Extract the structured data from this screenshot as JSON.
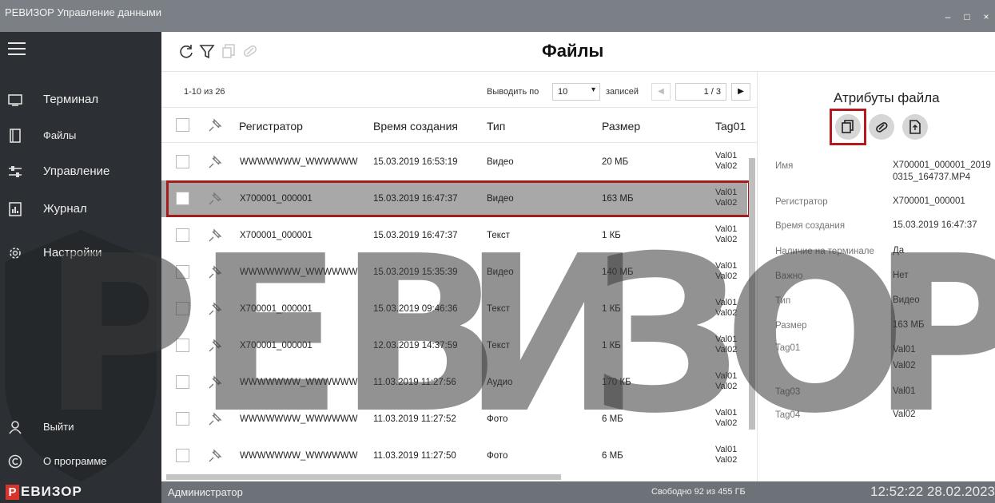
{
  "window": {
    "title": "РЕВИЗОР Управление данными",
    "buttons": [
      "–",
      "□",
      "×"
    ]
  },
  "sidebar": {
    "items": [
      {
        "label": "Терминал",
        "icon": "terminal-icon"
      },
      {
        "label": "Файлы",
        "icon": "files-icon"
      },
      {
        "label": "Управление",
        "icon": "sliders-icon"
      },
      {
        "label": "Журнал",
        "icon": "journal-icon"
      },
      {
        "label": "Настройки",
        "icon": "gear-icon"
      }
    ],
    "bottom": [
      {
        "label": "Выйти",
        "icon": "user-icon"
      },
      {
        "label": "О программе",
        "icon": "copyright-icon"
      }
    ]
  },
  "toolbar": {
    "title": "Файлы",
    "tools": [
      "refresh-icon",
      "filter-icon",
      "copy-icon",
      "erase-icon"
    ]
  },
  "pager": {
    "count_text": "1-10 из 26",
    "per_page_label": "Выводить по",
    "per_page_value": "10",
    "records_label": "записей",
    "page_text": "1 / 3",
    "prev": "◀",
    "next": "▶"
  },
  "table": {
    "columns": [
      "Регистратор",
      "Время создания",
      "Тип",
      "Размер",
      "Tag01"
    ],
    "rows": [
      {
        "registrator": "WWWWWWW_WWWWWW",
        "created": "15.03.2019 16:53:19",
        "type": "Видео",
        "size": "20 МБ",
        "tag1": "Val01",
        "tag2": "Val02"
      },
      {
        "registrator": "X700001_000001",
        "created": "15.03.2019 16:47:37",
        "type": "Видео",
        "size": "163 МБ",
        "tag1": "Val01",
        "tag2": "Val02"
      },
      {
        "registrator": "X700001_000001",
        "created": "15.03.2019 16:47:37",
        "type": "Текст",
        "size": "1 КБ",
        "tag1": "Val01",
        "tag2": "Val02"
      },
      {
        "registrator": "WWWWWWW_WWWWWW",
        "created": "15.03.2019 15:35:39",
        "type": "Видео",
        "size": "140 МБ",
        "tag1": "Val01",
        "tag2": "Val02"
      },
      {
        "registrator": "X700001_000001",
        "created": "15.03.2019 09:46:36",
        "type": "Текст",
        "size": "1 КБ",
        "tag1": "Val01",
        "tag2": "Val02"
      },
      {
        "registrator": "X700001_000001",
        "created": "12.03.2019 14:37:59",
        "type": "Текст",
        "size": "1 КБ",
        "tag1": "Val01",
        "tag2": "Val02"
      },
      {
        "registrator": "WWWWWWW_WWWWWW",
        "created": "11.03.2019 11:27:56",
        "type": "Аудио",
        "size": "170 КБ",
        "tag1": "Val01",
        "tag2": "Val02"
      },
      {
        "registrator": "WWWWWWW_WWWWWW",
        "created": "11.03.2019 11:27:52",
        "type": "Фото",
        "size": "6 МБ",
        "tag1": "Val01",
        "tag2": "Val02"
      },
      {
        "registrator": "WWWWWWW_WWWWWW",
        "created": "11.03.2019 11:27:50",
        "type": "Фото",
        "size": "6 МБ",
        "tag1": "Val01",
        "tag2": "Val02"
      }
    ],
    "selected_row_index": 1
  },
  "attributes": {
    "title": "Атрибуты файла",
    "buttons": [
      "copy-file-icon",
      "erase-icon",
      "export-file-icon"
    ],
    "fields": [
      {
        "key": "Имя",
        "value": "X700001_000001_2019\n0315_164737.MP4"
      },
      {
        "key": "Регистратор",
        "value": "X700001_000001"
      },
      {
        "key": "Время создания",
        "value": "15.03.2019 16:47:37"
      },
      {
        "key": "Наличие на терминале",
        "value": "Да"
      },
      {
        "key": "Важно",
        "value": "Нет"
      },
      {
        "key": "Тип",
        "value": "Видео"
      },
      {
        "key": "Размер",
        "value": "163 МБ"
      },
      {
        "key": "Tag01",
        "value": "Val01\nVal02"
      },
      {
        "key": "Tag03",
        "value": "Val01"
      },
      {
        "key": "Tag04",
        "value": "Val02"
      }
    ]
  },
  "status": {
    "brand_letter": "Р",
    "brand": "ЕВИЗОР",
    "user": "Администратор",
    "free_space": "Свободно 92 из 455 ГБ",
    "clock": "12:52:22 28.02.2023"
  },
  "watermark": {
    "letters": [
      "Р",
      "Е",
      "В",
      "И",
      "З",
      "О",
      "Р"
    ]
  },
  "colors": {
    "sidebar": "#2c2f33",
    "titlebar": "#7b7f86",
    "accent_red": "#a01e1e",
    "selected_row": "#a8a8a8"
  }
}
